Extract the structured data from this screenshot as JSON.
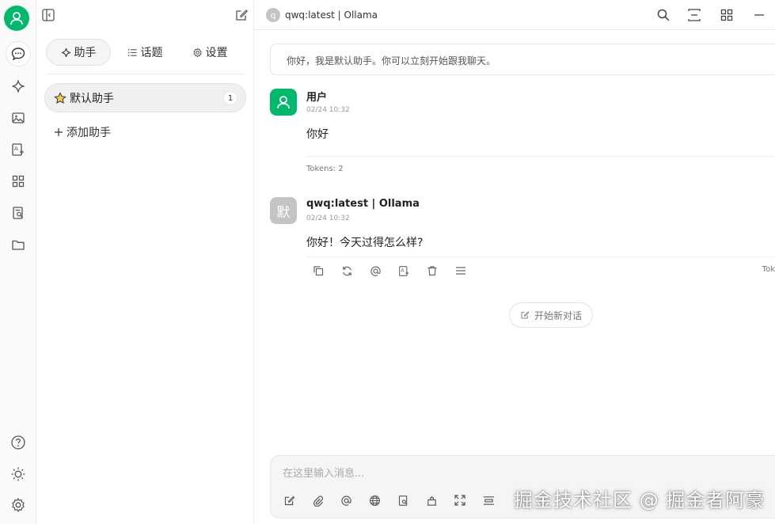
{
  "colors": {
    "accent": "#00b96b",
    "model_avatar": "#c4c4c4"
  },
  "rail": {
    "icons": [
      "chat-icon",
      "sparkle-icon",
      "image-icon",
      "translate-icon",
      "apps-icon",
      "knowledge-icon",
      "folder-icon",
      "help-icon",
      "theme-icon",
      "settings-icon"
    ]
  },
  "panel": {
    "tabs": [
      {
        "label": "助手",
        "icon": "sparkle-icon"
      },
      {
        "label": "话题",
        "icon": "list-icon"
      },
      {
        "label": "设置",
        "icon": "gear-icon"
      }
    ],
    "assistant": {
      "label": "默认助手",
      "count": "1",
      "icon": "star-icon"
    },
    "add_label": "添加助手"
  },
  "header": {
    "avatar_letter": "q",
    "model": "qwq:latest | Ollama"
  },
  "prompt": "你好，我是默认助手。你可以立刻开始跟我聊天。",
  "messages": {
    "user": {
      "name": "用户",
      "time": "02/24 10:32",
      "text": "你好",
      "tokens": "Tokens: 2"
    },
    "assistant": {
      "avatar_char": "默",
      "name": "qwq:latest | Ollama",
      "time": "02/24 10:32",
      "text": "你好！今天过得怎么样?",
      "tokens_partial": "Tok"
    }
  },
  "new_chat_label": "开始新对话",
  "input": {
    "placeholder": "在这里输入消息..."
  },
  "watermark": "掘金技术社区 @ 掘金者阿豪"
}
